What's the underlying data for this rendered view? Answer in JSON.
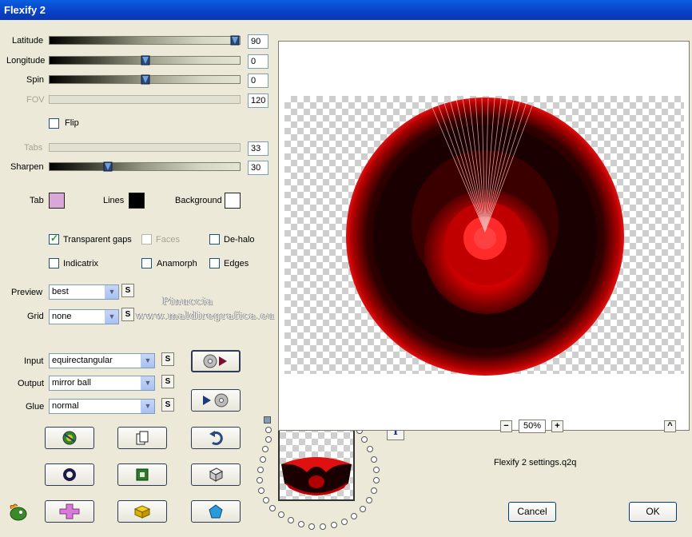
{
  "window": {
    "title": "Flexify 2"
  },
  "sliders": [
    {
      "label": "Latitude",
      "value": "90",
      "position": 1.0,
      "enabled": true
    },
    {
      "label": "Longitude",
      "value": "0",
      "position": 0.5,
      "enabled": true
    },
    {
      "label": "Spin",
      "value": "0",
      "position": 0.5,
      "enabled": true
    },
    {
      "label": "FOV",
      "value": "120",
      "position": 0.0,
      "enabled": false
    },
    {
      "label": "Tabs",
      "value": "33",
      "position": 0.0,
      "enabled": false
    },
    {
      "label": "Sharpen",
      "value": "30",
      "position": 0.3,
      "enabled": true
    }
  ],
  "flip": {
    "label": "Flip",
    "checked": false
  },
  "colors": {
    "tab": {
      "label": "Tab",
      "color": "#d8a8d8"
    },
    "lines": {
      "label": "Lines",
      "color": "#000000"
    },
    "background": {
      "label": "Background",
      "color": "#ffffff"
    }
  },
  "options": {
    "transparent_gaps": {
      "label": "Transparent gaps",
      "checked": true
    },
    "faces": {
      "label": "Faces",
      "checked": false,
      "enabled": false
    },
    "de_halo": {
      "label": "De-halo",
      "checked": false
    },
    "indicatrix": {
      "label": "Indicatrix",
      "checked": false
    },
    "anamorph": {
      "label": "Anamorph",
      "checked": false
    },
    "edges": {
      "label": "Edges",
      "checked": false
    }
  },
  "preview_select": {
    "label": "Preview",
    "value": "best"
  },
  "grid_select": {
    "label": "Grid",
    "value": "none"
  },
  "input_select": {
    "label": "Input",
    "value": "equirectangular"
  },
  "output_select": {
    "label": "Output",
    "value": "mirror ball"
  },
  "glue_select": {
    "label": "Glue",
    "value": "normal"
  },
  "small_button_label": "S",
  "watermark": {
    "line1": "Pinuccia",
    "line2": "www.maldiregrafica.eu"
  },
  "zoom": {
    "minus": "−",
    "value": "50%",
    "plus": "+"
  },
  "collapse_label": "^",
  "info_label": "i",
  "settings_file": "Flexify 2 settings.q2q",
  "buttons": {
    "cancel": "Cancel",
    "ok": "OK"
  },
  "accent_red": "#e00000",
  "title_blue": "#0a3fc8"
}
